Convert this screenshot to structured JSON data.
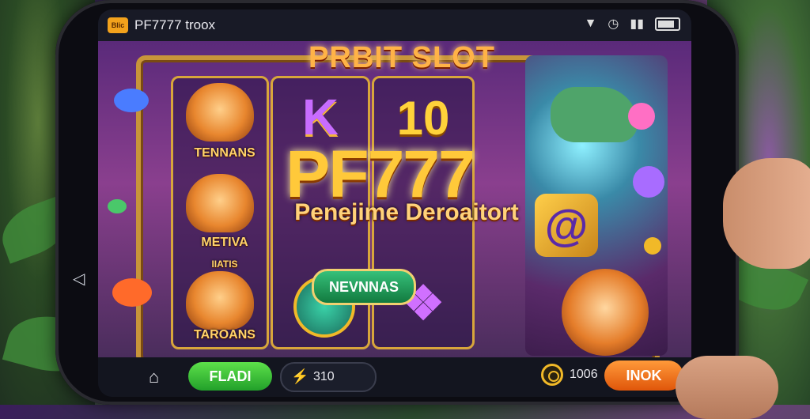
{
  "status_bar": {
    "app_badge": "Blic",
    "app_title": "PF7777 troox",
    "icons": [
      "notification-icon",
      "alarm-icon",
      "signal-icon",
      "battery-icon"
    ]
  },
  "game": {
    "title": "PRBIT SLOT",
    "logo": "PF777",
    "logo_subtitle": "Penejime Deroaitort",
    "reel_labels": [
      "TENNANS",
      "METIVA",
      "TAROANS"
    ],
    "reel_symbols": [
      "K",
      "10",
      "@"
    ],
    "center_button_label": "NEVNNAS",
    "tile_caption_top": "IIATIS"
  },
  "bottom_bar": {
    "play_label": "FLADI",
    "bet_value": "310",
    "credit_value": "1006",
    "spin_label": "INOK"
  },
  "colors": {
    "accent_gold": "#f1b928",
    "play_green": "#22a02a",
    "spin_orange": "#e0560a"
  }
}
